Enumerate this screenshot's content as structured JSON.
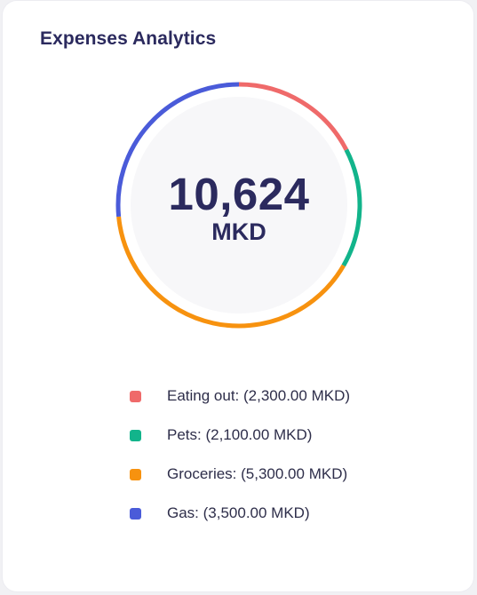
{
  "card": {
    "title": "Expenses Analytics"
  },
  "summary": {
    "total": "10,624",
    "currency": "MKD"
  },
  "colors": {
    "eating_out": "#ef6a6a",
    "pets": "#12b48b",
    "groceries": "#f7920f",
    "gas": "#4a5bd9",
    "title_text": "#2b2a5e"
  },
  "legend": [
    {
      "label": "Eating out: (2,300.00 MKD)",
      "color": "#ef6a6a",
      "swatch_icon": "square-swatch"
    },
    {
      "label": "Pets: (2,100.00 MKD)",
      "color": "#12b48b",
      "swatch_icon": "square-swatch"
    },
    {
      "label": "Groceries: (5,300.00 MKD)",
      "color": "#f7920f",
      "swatch_icon": "square-swatch"
    },
    {
      "label": "Gas: (3,500.00 MKD)",
      "color": "#4a5bd9",
      "swatch_icon": "square-swatch"
    }
  ],
  "chart_data": {
    "type": "pie",
    "categories": [
      "Eating out",
      "Pets",
      "Groceries",
      "Gas"
    ],
    "values": [
      2300,
      2100,
      5300,
      3500
    ],
    "colors": [
      "#ef6a6a",
      "#12b48b",
      "#f7920f",
      "#4a5bd9"
    ],
    "title": "Expenses Analytics"
  }
}
